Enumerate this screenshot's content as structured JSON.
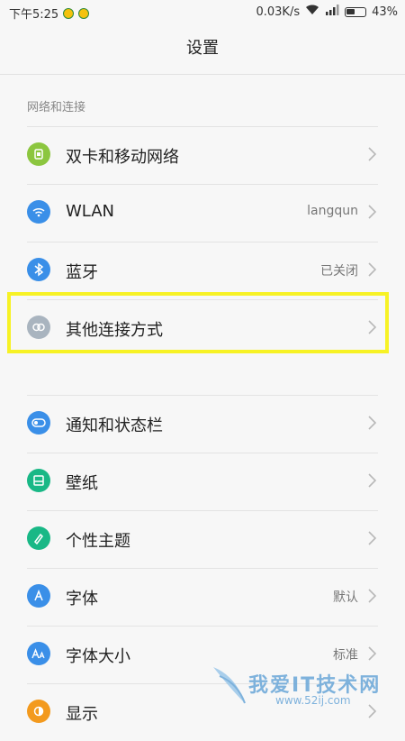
{
  "status_bar": {
    "time": "下午5:25",
    "speed": "0.03K/s",
    "battery": "43%"
  },
  "header": {
    "title": "设置"
  },
  "sections": [
    {
      "header": "网络和连接",
      "items": [
        {
          "label": "双卡和移动网络",
          "value": "",
          "icon": "sim-card-icon",
          "icon_color": "#8cc63f"
        },
        {
          "label": "WLAN",
          "value": "langqun",
          "icon": "wifi-icon",
          "icon_color": "#3a8fe8"
        },
        {
          "label": "蓝牙",
          "value": "已关闭",
          "icon": "bluetooth-icon",
          "icon_color": "#3a8fe8"
        },
        {
          "label": "其他连接方式",
          "value": "",
          "icon": "link-icon",
          "icon_color": "#a9b4bf"
        }
      ]
    },
    {
      "header": "",
      "items": [
        {
          "label": "通知和状态栏",
          "value": "",
          "icon": "toggle-icon",
          "icon_color": "#3a8fe8"
        },
        {
          "label": "壁纸",
          "value": "",
          "icon": "wallpaper-icon",
          "icon_color": "#19b886"
        },
        {
          "label": "个性主题",
          "value": "",
          "icon": "brush-icon",
          "icon_color": "#19b886"
        },
        {
          "label": "字体",
          "value": "默认",
          "icon": "font-icon",
          "icon_color": "#3a8fe8"
        },
        {
          "label": "字体大小",
          "value": "标准",
          "icon": "font-size-icon",
          "icon_color": "#3a8fe8"
        },
        {
          "label": "显示",
          "value": "",
          "icon": "display-icon",
          "icon_color": "#f39a1e"
        }
      ]
    }
  ],
  "highlight": {
    "color": "#f7f225"
  },
  "watermark": {
    "brand": "我爱IT技术网",
    "url": "www.52ij.com"
  }
}
